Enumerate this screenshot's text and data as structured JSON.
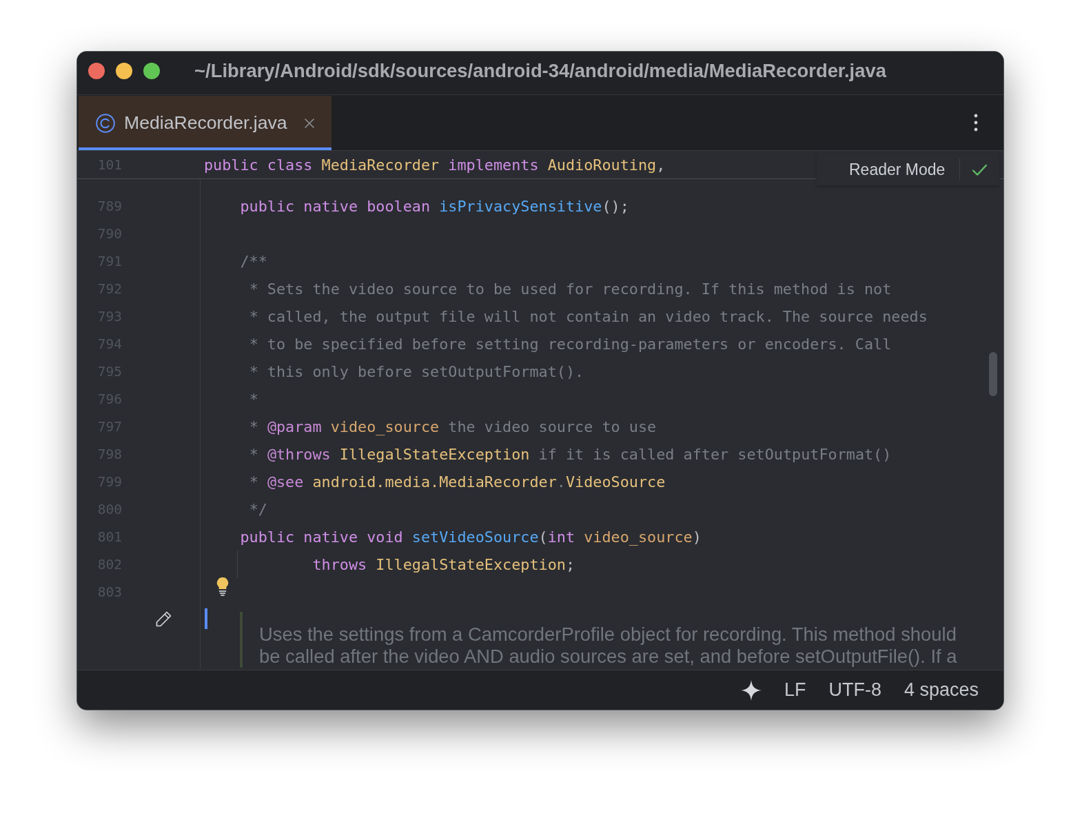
{
  "window": {
    "title": "~/Library/Android/sdk/sources/android-34/android/media/MediaRecorder.java"
  },
  "tabs": [
    {
      "label": "MediaRecorder.java",
      "selected": true
    }
  ],
  "editor": {
    "sticky_line": {
      "number": "101",
      "tokens": [
        {
          "kind": "keyword",
          "text": "public class "
        },
        {
          "kind": "type",
          "text": "MediaRecorder"
        },
        {
          "kind": "keyword",
          "text": " implements "
        },
        {
          "kind": "type",
          "text": "AudioRouting"
        },
        {
          "kind": "plain",
          "text": ","
        }
      ]
    },
    "reader_mode": {
      "label": "Reader Mode"
    },
    "lines": [
      {
        "number": "789",
        "tokens": [
          {
            "kind": "keyword",
            "text": "    public native boolean "
          },
          {
            "kind": "method",
            "text": "isPrivacySensitive"
          },
          {
            "kind": "plain",
            "text": "();"
          }
        ]
      },
      {
        "number": "790"
      },
      {
        "number": "791",
        "tokens": [
          {
            "kind": "comment",
            "text": "    /**"
          }
        ]
      },
      {
        "number": "792",
        "tokens": [
          {
            "kind": "comment",
            "text": "     * Sets the video source to be used for recording. If this method is not"
          }
        ]
      },
      {
        "number": "793",
        "tokens": [
          {
            "kind": "comment",
            "text": "     * called, the output file will not contain an video track. The source needs"
          }
        ]
      },
      {
        "number": "794",
        "tokens": [
          {
            "kind": "comment",
            "text": "     * to be specified before setting recording-parameters or encoders. Call"
          }
        ]
      },
      {
        "number": "795",
        "tokens": [
          {
            "kind": "comment",
            "text": "     * this only before setOutputFormat()."
          }
        ]
      },
      {
        "number": "796",
        "tokens": [
          {
            "kind": "comment",
            "text": "     *"
          }
        ]
      },
      {
        "number": "797",
        "tokens": [
          {
            "kind": "comment",
            "text": "     * "
          },
          {
            "kind": "tag",
            "text": "@param "
          },
          {
            "kind": "param",
            "text": "video_source"
          },
          {
            "kind": "comment",
            "text": " the video source to use"
          }
        ]
      },
      {
        "number": "798",
        "tokens": [
          {
            "kind": "comment",
            "text": "     * "
          },
          {
            "kind": "tag",
            "text": "@throws "
          },
          {
            "kind": "type",
            "text": "IllegalStateException"
          },
          {
            "kind": "comment",
            "text": " if it is called after setOutputFormat()"
          }
        ]
      },
      {
        "number": "799",
        "tokens": [
          {
            "kind": "comment",
            "text": "     * "
          },
          {
            "kind": "tag",
            "text": "@see "
          },
          {
            "kind": "type",
            "text": "android.media.MediaRecorder"
          },
          {
            "kind": "comment",
            "text": "."
          },
          {
            "kind": "type",
            "text": "VideoSource"
          }
        ]
      },
      {
        "number": "800",
        "tokens": [
          {
            "kind": "comment",
            "text": "     */"
          }
        ]
      },
      {
        "number": "801",
        "tokens": [
          {
            "kind": "keyword",
            "text": "    public native void "
          },
          {
            "kind": "method",
            "text": "setVideoSource"
          },
          {
            "kind": "plain",
            "text": "("
          },
          {
            "kind": "keyword",
            "text": "int "
          },
          {
            "kind": "param",
            "text": "video_source"
          },
          {
            "kind": "plain",
            "text": ")"
          }
        ]
      },
      {
        "number": "802",
        "tokens": [
          {
            "kind": "keyword",
            "text": "            throws "
          },
          {
            "kind": "type",
            "text": "IllegalStateException"
          },
          {
            "kind": "plain",
            "text": ";"
          }
        ]
      },
      {
        "number": "803"
      }
    ],
    "rendered_doc": {
      "lines": [
        "Uses the settings from a CamcorderProfile object for recording. This method should",
        "be called after the video AND audio sources are set, and before setOutputFile(). If a"
      ]
    }
  },
  "status_bar": {
    "items": [
      "LF",
      "UTF-8",
      "4 spaces"
    ]
  }
}
